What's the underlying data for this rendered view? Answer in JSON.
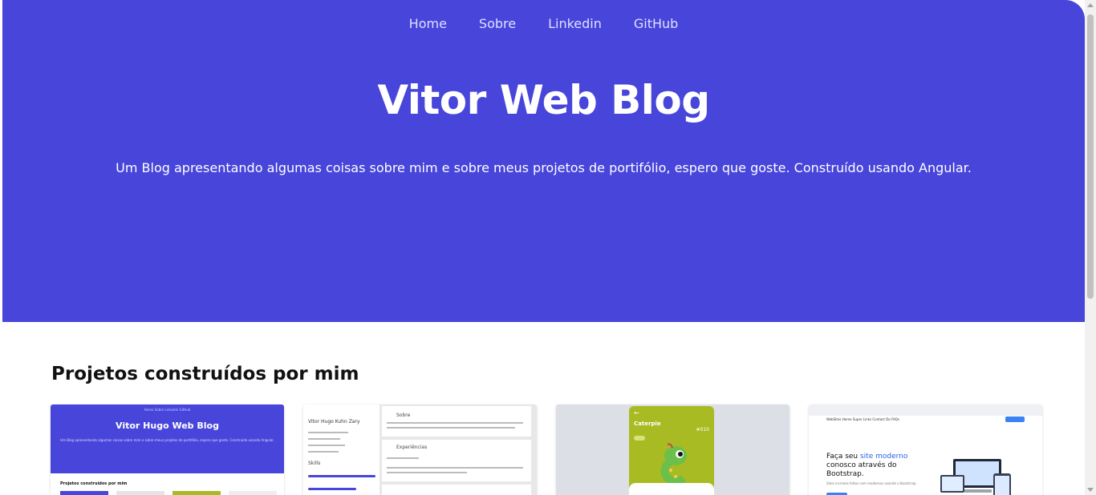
{
  "nav": {
    "items": [
      "Home",
      "Sobre",
      "Linkedin",
      "GitHub"
    ]
  },
  "hero": {
    "title": "Vitor Web Blog",
    "subtitle": "Um Blog apresentando algumas coisas sobre mim e sobre meus projetos de portifólio, espero que goste. Construído usando Angular."
  },
  "projects": {
    "title": "Projetos construídos por mim",
    "cards": [
      {
        "kind": "blog-preview",
        "nav_text": "Home  Sobre  Linkedin  GitHub",
        "title": "Vitor Hugo Web Blog",
        "subtitle": "Um Blog apresentando algumas coisas sobre mim e sobre meus projetos de portifólio, espero que goste. Construído usando Angular.",
        "section": "Projetos construídos por mim"
      },
      {
        "kind": "curriculum-preview",
        "name": "Vitor Hugo Kuhn Zary",
        "sections": [
          "Sobre",
          "Experiências"
        ],
        "skills_label": "Skills"
      },
      {
        "kind": "pokedex-preview",
        "pokemon": "Caterpie",
        "number": "#010"
      },
      {
        "kind": "landing-preview",
        "nav_text": "WebSites   Home   Super Links   Contact   Do FAQs",
        "headline_pre": "Faça seu ",
        "headline_highlight": "site moderno",
        "headline_post": "conosco através do Bootstrap.",
        "subtext": "Sites incríveis feitos com modernos usando o Bootstrap."
      }
    ]
  },
  "colors": {
    "hero_bg": "#4845db",
    "text_dark": "#111111",
    "pokemon_green": "#a8bb22"
  }
}
